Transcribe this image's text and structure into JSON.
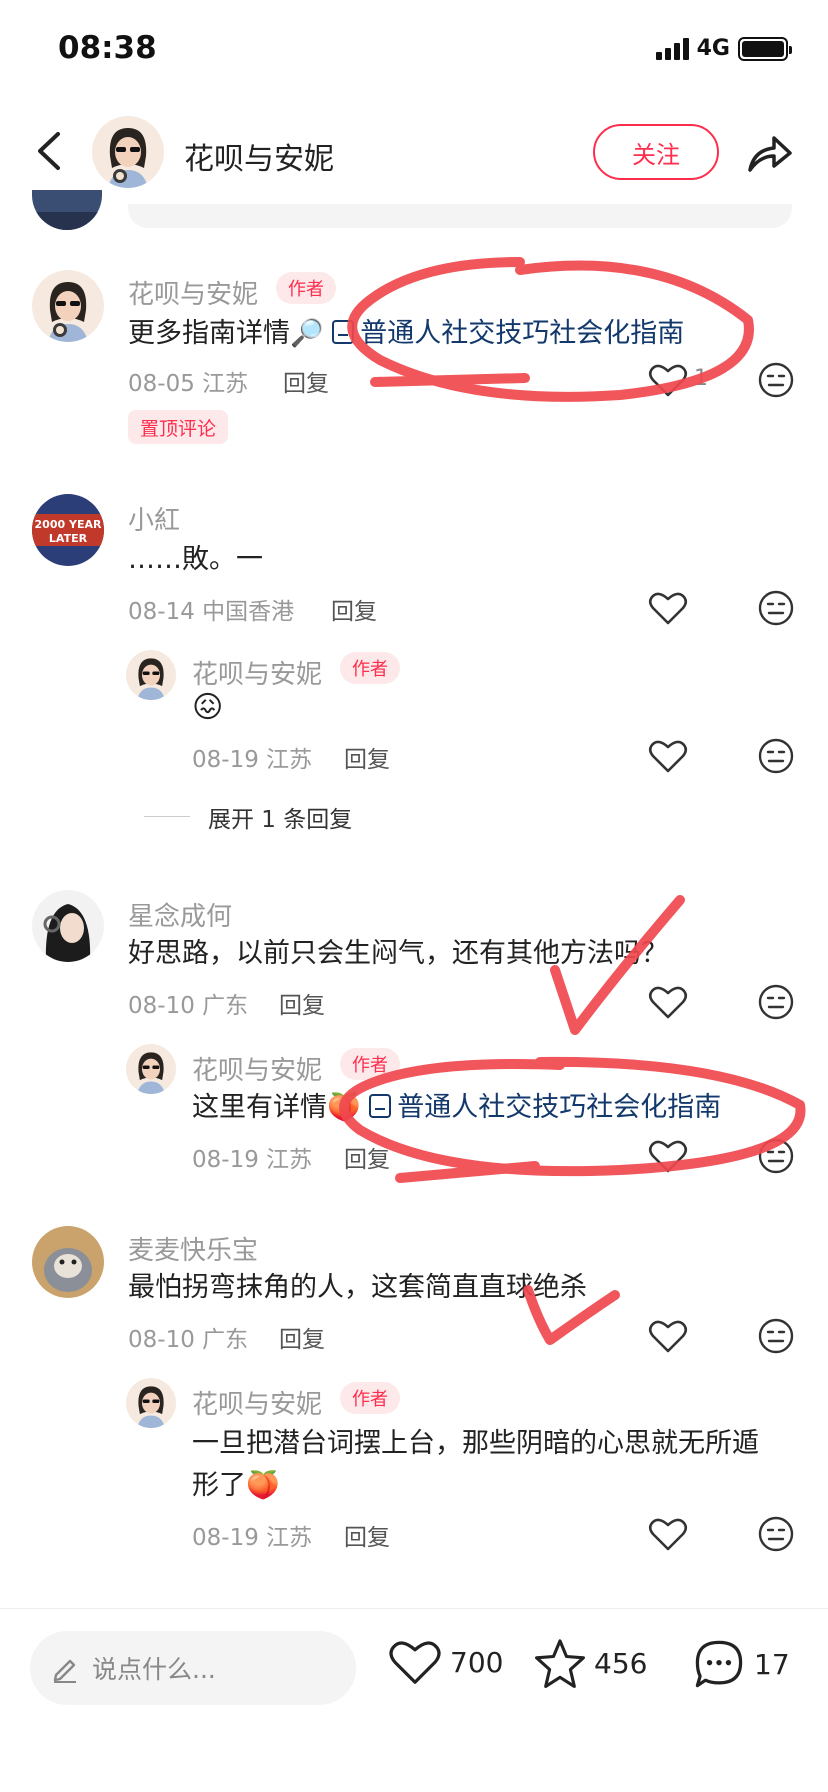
{
  "status_bar": {
    "time": "08:38",
    "network": "4G"
  },
  "header": {
    "author_name": "花呗与安妮",
    "follow_label": "关注"
  },
  "comments": [
    {
      "name": "花呗与安妮",
      "badge": "作者",
      "text_prefix": "更多指南详情🔎",
      "link_text": "普通人社交技巧社会化指南",
      "date": "08-05 江苏",
      "reply": "回复",
      "likes": "1",
      "pinned": "置顶评论"
    },
    {
      "name": "小紅",
      "text": "……敗。一",
      "date": "08-14 中国香港",
      "reply": "回复",
      "avatar_text": "2000 YEAR LATER",
      "sub": {
        "name": "花呗与安妮",
        "badge": "作者",
        "date": "08-19 江苏",
        "reply": "回复"
      },
      "expand": "展开 1 条回复"
    },
    {
      "name": "星念成何",
      "text": "好思路，以前只会生闷气，还有其他方法吗？",
      "date": "08-10 广东",
      "reply": "回复",
      "sub": {
        "name": "花呗与安妮",
        "badge": "作者",
        "text_prefix": "这里有详情",
        "link_text": "普通人社交技巧社会化指南",
        "date": "08-19 江苏",
        "reply": "回复"
      }
    },
    {
      "name": "麦麦快乐宝",
      "text": "最怕拐弯抹角的人，这套简直直球绝杀",
      "date": "08-10 广东",
      "reply": "回复",
      "sub": {
        "name": "花呗与安妮",
        "badge": "作者",
        "text_line1": "一旦把潜台词摆上台，那些阴暗的心思就无所遁",
        "text_line2": "形了",
        "date": "08-19 江苏",
        "reply": "回复"
      }
    }
  ],
  "bottom_bar": {
    "input_placeholder": "说点什么...",
    "likes": "700",
    "stars": "456",
    "comments": "17"
  },
  "colors": {
    "accent": "#ff2e4d",
    "link": "#13386c",
    "annotation": "#f0484e"
  }
}
